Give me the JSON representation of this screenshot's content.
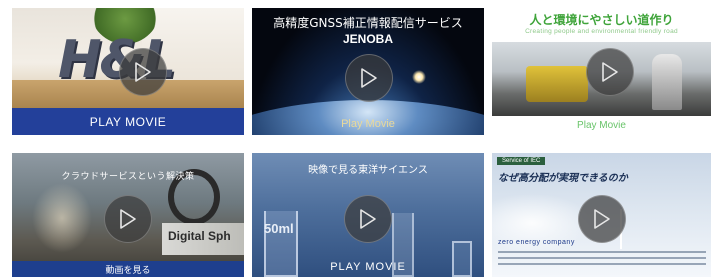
{
  "tiles": [
    {
      "logo_text": "H&L",
      "play_label": "PLAY MOVIE",
      "bar_color": "#23409a"
    },
    {
      "title": "高精度GNSS補正情報配信サービス",
      "brand": "JENOBA",
      "caption": "Play Movie",
      "caption_color": "#e9d99a"
    },
    {
      "title": "人と環境にやさしい道作り",
      "subtitle": "Creating people and environmental friendly road",
      "caption": "Play Movie",
      "caption_color": "#69c46a"
    },
    {
      "title": "クラウドサービスという解決策",
      "sign_text": "Digital Sph",
      "caption": "動画を見る"
    },
    {
      "title": "映像で見る東洋サイエンス",
      "beaker_label": "50ml",
      "caption": "PLAY MOVIE"
    },
    {
      "label": "Service of IEC",
      "title": "なぜ高分配が実現できるのか",
      "logo_text": "zero energy company"
    }
  ],
  "icons": {
    "play": "play-icon"
  }
}
